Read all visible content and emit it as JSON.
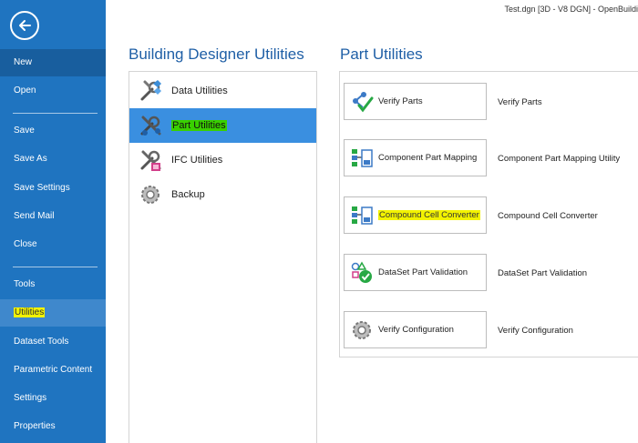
{
  "window": {
    "title": "Test.dgn [3D - V8 DGN] - OpenBuildi"
  },
  "sidebar": {
    "items": [
      {
        "label": "New"
      },
      {
        "label": "Open"
      },
      {
        "label": "Save"
      },
      {
        "label": "Save As"
      },
      {
        "label": "Save Settings"
      },
      {
        "label": "Send Mail"
      },
      {
        "label": "Close"
      },
      {
        "label": "Tools"
      },
      {
        "label": "Utilities"
      },
      {
        "label": "Dataset Tools"
      },
      {
        "label": "Parametric Content"
      },
      {
        "label": "Settings"
      },
      {
        "label": "Properties"
      }
    ]
  },
  "left_section": {
    "title": "Building Designer Utilities",
    "items": [
      {
        "label": "Data Utilities",
        "icon": "data-utilities-icon"
      },
      {
        "label": "Part Utilities",
        "icon": "part-utilities-icon"
      },
      {
        "label": "IFC Utilities",
        "icon": "ifc-utilities-icon"
      },
      {
        "label": "Backup",
        "icon": "backup-icon"
      }
    ]
  },
  "right_section": {
    "title": "Part Utilities",
    "items": [
      {
        "label": "Verify Parts",
        "description": "Verify Parts",
        "icon": "verify-parts-icon"
      },
      {
        "label": "Component Part Mapping",
        "description": "Component Part Mapping Utility",
        "icon": "component-mapping-icon"
      },
      {
        "label": "Compound Cell Converter",
        "description": "Compound Cell Converter",
        "icon": "cell-converter-icon"
      },
      {
        "label": "DataSet Part Validation",
        "description": "DataSet Part Validation",
        "icon": "dataset-validation-icon"
      },
      {
        "label": "Verify Configuration",
        "description": "Verify Configuration",
        "icon": "verify-configuration-icon"
      }
    ]
  },
  "colors": {
    "sidebar_bg": "#1f74c0",
    "sidebar_selected": "#185e9e",
    "accent_title": "#1f5fa6",
    "active_category": "#3a8fe0",
    "highlight_yellow": "#f2f200",
    "highlight_green": "#39d000"
  }
}
